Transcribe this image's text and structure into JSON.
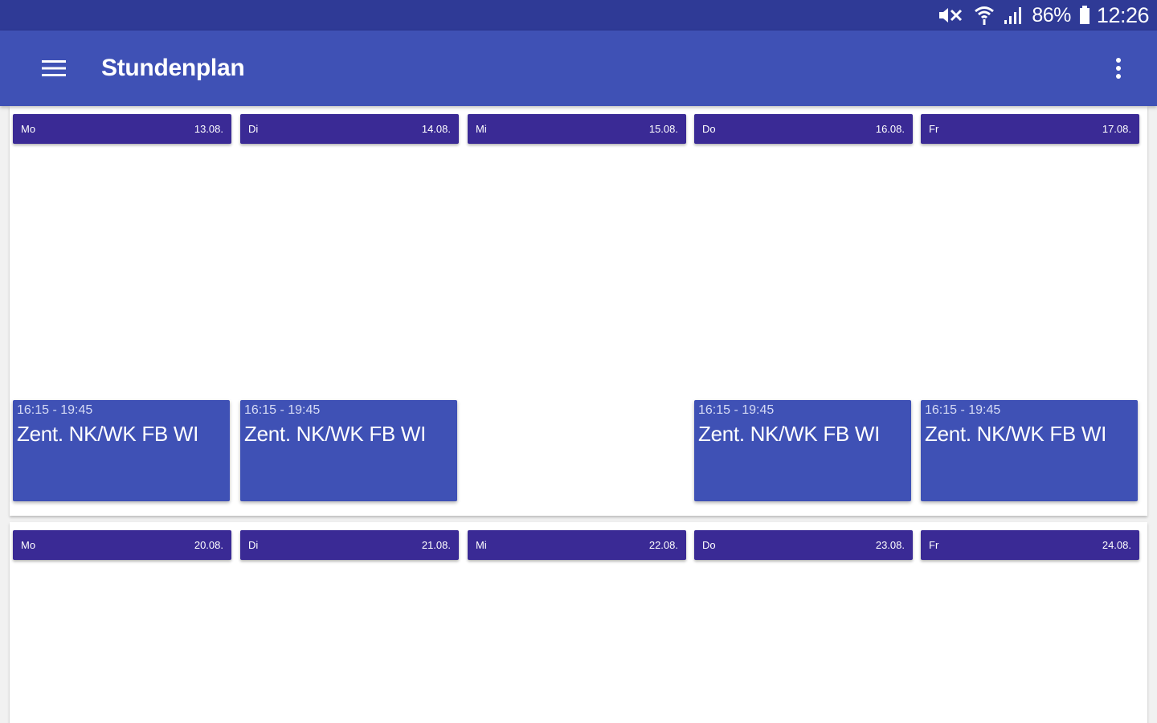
{
  "status_bar": {
    "battery_percent": "86%",
    "time": "12:26",
    "icons": [
      "mute-icon",
      "wifi-icon",
      "signal-icon",
      "battery-icon"
    ]
  },
  "app_bar": {
    "title": "Stundenplan",
    "menu_icon": "hamburger-menu-icon",
    "overflow_icon": "more-vert-icon"
  },
  "colors": {
    "app_bar": "#3f51b5",
    "status_bar": "#2f3a96",
    "day_header": "#3a2a95",
    "lesson": "#3f51b5"
  },
  "weeks": [
    {
      "days": [
        {
          "name": "Mo",
          "date": "13.08."
        },
        {
          "name": "Di",
          "date": "14.08."
        },
        {
          "name": "Mi",
          "date": "15.08."
        },
        {
          "name": "Do",
          "date": "16.08."
        },
        {
          "name": "Fr",
          "date": "17.08."
        }
      ],
      "lessons": [
        {
          "day": "Mo",
          "time": "16:15 - 19:45",
          "title": "Zent. NK/WK FB WI"
        },
        {
          "day": "Di",
          "time": "16:15 - 19:45",
          "title": "Zent. NK/WK FB WI"
        },
        {
          "day": "Do",
          "time": "16:15 - 19:45",
          "title": "Zent. NK/WK FB WI"
        },
        {
          "day": "Fr",
          "time": "16:15 - 19:45",
          "title": "Zent. NK/WK FB WI"
        }
      ]
    },
    {
      "days": [
        {
          "name": "Mo",
          "date": "20.08."
        },
        {
          "name": "Di",
          "date": "21.08."
        },
        {
          "name": "Mi",
          "date": "22.08."
        },
        {
          "name": "Do",
          "date": "23.08."
        },
        {
          "name": "Fr",
          "date": "24.08."
        }
      ],
      "lessons": []
    }
  ]
}
